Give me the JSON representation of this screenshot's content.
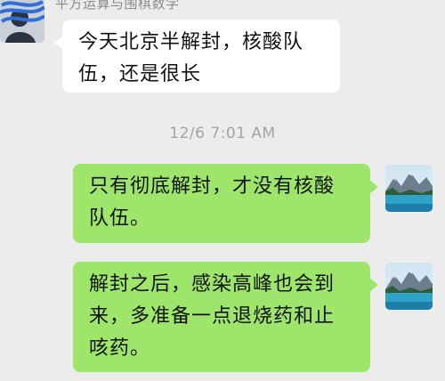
{
  "chat": {
    "sender_name": "平方运算与围棋数学",
    "timestamp": "12/6 7:01 AM",
    "messages": [
      {
        "side": "left",
        "text": "今天北京半解封，核酸队\n伍，还是很长"
      },
      {
        "side": "right",
        "text": "只有彻底解封，才没有核酸\n队伍。"
      },
      {
        "side": "right",
        "text": "解封之后，感染高峰也会到\n来，多准备一点退烧药和止\n咳药。"
      }
    ]
  },
  "colors": {
    "background": "#ececec",
    "incoming_bubble": "#ffffff",
    "outgoing_bubble": "#9de66b",
    "timestamp_text": "#a3a3a3"
  },
  "icons": {
    "left_avatar": "user-avatar-icon",
    "right_avatar": "mountain-lake-avatar-icon"
  }
}
